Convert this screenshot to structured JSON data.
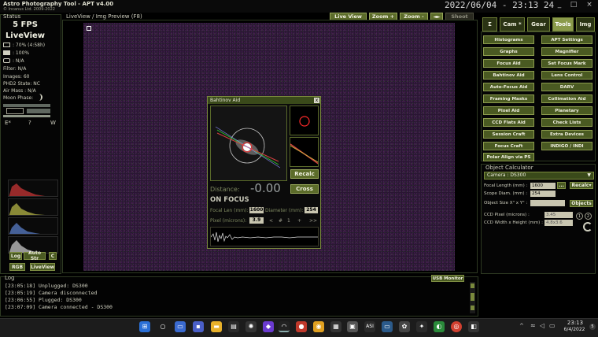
{
  "app": {
    "title": "Astro Photography Tool  -  APT v4.00",
    "subtitle": "© Incanus Ltd. 2009-2022",
    "clock": "2022/06/04 - 23:13 24"
  },
  "window_controls": {
    "minimize": "_",
    "maximize": "□",
    "close": "×"
  },
  "status": {
    "title": "Status",
    "fps": "5 FPS",
    "mode": "LiveView",
    "battery": ": 70% (4:58h)",
    "storage": ": 100%",
    "temp": ": N/A",
    "filter": "Filter: N/A",
    "images": "Images: 60",
    "phd2": "PHD2 State: NC",
    "airmass": "Air Mass : N/A",
    "moon": "Moon Phase:",
    "compass": {
      "e": "E*",
      "q": "?",
      "w": "W"
    },
    "buttons": {
      "log": "Log",
      "auto_str": "Auto Str",
      "c": "C",
      "rgb": "RGB",
      "liveview": "LiveView"
    }
  },
  "preview": {
    "label": "LiveView / Img Preview (F8)",
    "live_view": "Live View",
    "zoom_in": "Zoom +",
    "zoom_out": "Zoom -",
    "arrows": "◄►",
    "shoot": "Shoot"
  },
  "bahtinov": {
    "title": "Bahtinov Aid",
    "close": "x",
    "distance_label": "Distance:",
    "distance_value": "-0.00",
    "status": "ON FOCUS",
    "recalc": "Recalc",
    "cross": "Cross",
    "focal_len_label": "Focal Len (mm):",
    "focal_len": "1600",
    "diameter_label": "Diameter (mm):",
    "diameter": "254",
    "pixel_label": "Pixel (microns):",
    "pixel": "3.9",
    "nav_minus": "<",
    "nav_hash": "#",
    "nav_one": "1",
    "nav_plus": "+",
    "nav_fwd": ">>"
  },
  "tabs": [
    {
      "label": "Σ"
    },
    {
      "label": "Cam *"
    },
    {
      "label": "Gear"
    },
    {
      "label": "Tools"
    },
    {
      "label": "Img"
    }
  ],
  "tools": [
    [
      "Histograms",
      "APT Settings"
    ],
    [
      "Graphs",
      "Magnifier"
    ],
    [
      "Focus Aid",
      "Set Focus Mark"
    ],
    [
      "Bahtinov Aid",
      "Lens Control"
    ],
    [
      "Auto-Focus Aid",
      "DARV"
    ],
    [
      "Framing Masks",
      "Collimation Aid"
    ],
    [
      "Pixel Aid",
      "Planetary"
    ],
    [
      "CCD Flats Aid",
      "Check Lists"
    ],
    [
      "Session Craft",
      "Extra Devices"
    ],
    [
      "Focus Craft",
      "INDIGO / INDI"
    ],
    [
      "Polar Align via PS",
      ""
    ]
  ],
  "objcalc": {
    "title": "Object Calculator",
    "camera": "Camera : DS300",
    "focal_label": "Focal Length (mm) :",
    "focal": "1600",
    "dots": "...",
    "recalc": "Recalc",
    "scope_label": "Scope Diam. (mm) :",
    "scope": "254",
    "objsize_label": "Object Size X\" x Y\" :",
    "objects": "Objects",
    "ccd_pixel_label": "CCD Pixel (microns) :",
    "ccd_pixel": "3.45",
    "ccd_wh_label": "CCD Width x Height (mm) :",
    "ccd_wh": "4.8x3.6",
    "b1": "1",
    "b2": "2"
  },
  "log": {
    "title": "Log",
    "usb_monitor": "USB Monitor",
    "lines": [
      "[23:05:18] Unplugged: DS300",
      "[23:05:19] Camera disconnected",
      "[23:06:55] Plugged: DS300",
      "[23:07:09] Camera connected - DS300"
    ]
  },
  "taskbar": {
    "time": "23:13",
    "date": "6/4/2022",
    "notif": "5"
  },
  "colors": {
    "olive": "#4a5a22",
    "olive_border": "#8c9c4c",
    "background": "#000000"
  }
}
